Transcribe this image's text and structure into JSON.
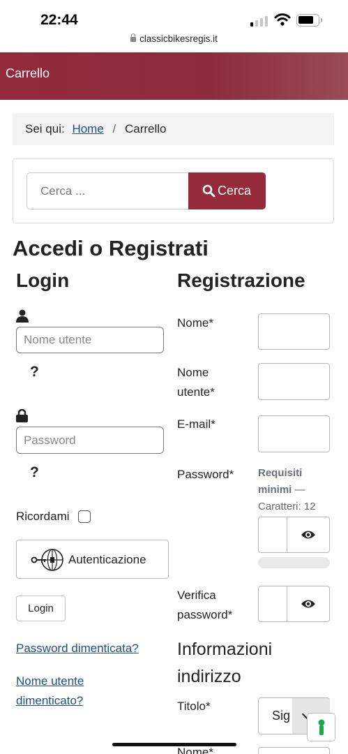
{
  "status_bar": {
    "time": "22:44",
    "url": "classicbikesregis.it"
  },
  "header": {
    "title": "Carrello"
  },
  "breadcrumb": {
    "prefix": "Sei qui:",
    "home": "Home",
    "separator": "/",
    "current": "Carrello"
  },
  "search": {
    "placeholder": "Cerca ...",
    "button_label": "Cerca"
  },
  "page_title": "Accedi o Registrati",
  "login": {
    "heading": "Login",
    "username_placeholder": "Nome utente",
    "help_mark": "?",
    "password_placeholder": "Password",
    "remember_label": "Ricordami",
    "auth_button": "Autenticazione",
    "login_button": "Login",
    "forgot_password": "Password dimenticata?",
    "forgot_username_line1": "Nome utente",
    "forgot_username_line2": "dimenticato?"
  },
  "registration": {
    "heading": "Registrazione",
    "name_label": "Nome*",
    "username_label_line1": "Nome",
    "username_label_line2": "utente*",
    "email_label": "E-mail*",
    "password_label": "Password*",
    "requirements_bold_1": "Requisiti",
    "requirements_bold_2": "minimi",
    "requirements_dash": " —",
    "requirements_chars": "Caratteri: 12",
    "verify_label_line1": "Verifica",
    "verify_label_line2": "password*",
    "address_heading_line1": "Informazioni",
    "address_heading_line2": "indirizzo",
    "title_label": "Titolo*",
    "title_value": "Sig",
    "next_label": "Nome*"
  },
  "colors": {
    "brand": "#952b3a",
    "link": "#1f4f86",
    "accessibility_icon": "#1fa64a"
  },
  "icons": [
    "lock-icon",
    "search-icon",
    "user-icon",
    "padlock-icon",
    "key-globe-icon",
    "eye-icon",
    "accessibility-icon"
  ]
}
